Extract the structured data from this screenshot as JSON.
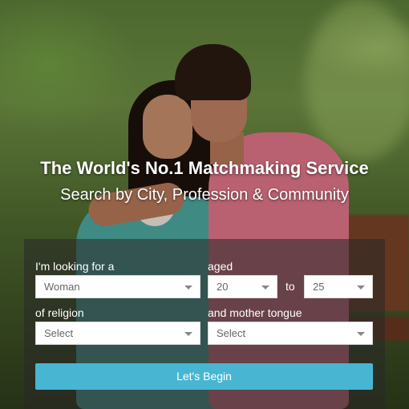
{
  "hero": {
    "headline": "The World's No.1 Matchmaking Service",
    "subheadline": "Search by City, Profession & Community"
  },
  "search_form": {
    "looking_for_label": "I'm looking for a",
    "looking_for_value": "Woman",
    "aged_label": "aged",
    "age_from_value": "20",
    "to_label": "to",
    "age_to_value": "25",
    "religion_label": "of religion",
    "religion_value": "Select",
    "mother_tongue_label": "and mother tongue",
    "mother_tongue_value": "Select",
    "submit_label": "Let's Begin"
  },
  "colors": {
    "button": "#48b6d3",
    "panel_overlay": "rgba(40,40,40,0.55)"
  },
  "icons": [
    "chevron-down-icon"
  ]
}
